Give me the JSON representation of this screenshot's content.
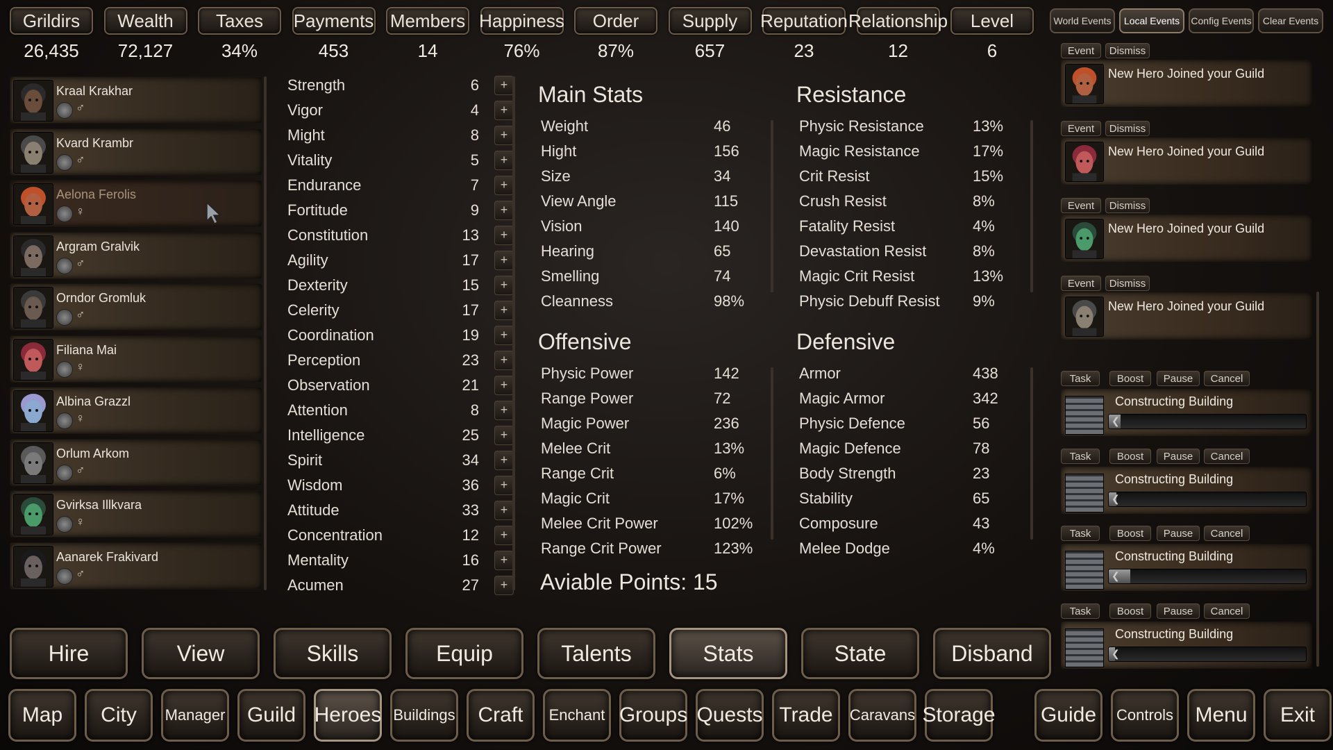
{
  "resources": [
    {
      "label": "Grildirs",
      "value": "26,435"
    },
    {
      "label": "Wealth",
      "value": "72,127"
    },
    {
      "label": "Taxes",
      "value": "34%"
    },
    {
      "label": "Payments",
      "value": "453"
    },
    {
      "label": "Members",
      "value": "14"
    },
    {
      "label": "Happiness",
      "value": "76%"
    },
    {
      "label": "Order",
      "value": "87%"
    },
    {
      "label": "Supply",
      "value": "657"
    },
    {
      "label": "Reputation",
      "value": "23"
    },
    {
      "label": "Relationship",
      "value": "12"
    },
    {
      "label": "Level",
      "value": "6"
    }
  ],
  "event_tabs": [
    "World Events",
    "Local Events",
    "Config Events",
    "Clear Events"
  ],
  "heroes": [
    {
      "name": "Kraal Krakhar",
      "gender": "♂"
    },
    {
      "name": "Kvard Krambr",
      "gender": "♂"
    },
    {
      "name": "Aelona Ferolis",
      "gender": "♀"
    },
    {
      "name": "Argram Gralvik",
      "gender": "♂"
    },
    {
      "name": "Orndor Gromluk",
      "gender": "♂"
    },
    {
      "name": "Filiana Mai",
      "gender": "♀"
    },
    {
      "name": "Albina Grazzl",
      "gender": "♀"
    },
    {
      "name": "Orlum Arkom",
      "gender": "♂"
    },
    {
      "name": "Gvirksa Illkvara",
      "gender": "♀"
    },
    {
      "name": "Aanarek Frakivard",
      "gender": "♂"
    }
  ],
  "attributes": [
    {
      "name": "Strength",
      "value": "6"
    },
    {
      "name": "Vigor",
      "value": "4"
    },
    {
      "name": "Might",
      "value": "8"
    },
    {
      "name": "Vitality",
      "value": "5"
    },
    {
      "name": "Endurance",
      "value": "7"
    },
    {
      "name": "Fortitude",
      "value": "9"
    },
    {
      "name": "Constitution",
      "value": "13"
    },
    {
      "name": "Agility",
      "value": "17"
    },
    {
      "name": "Dexterity",
      "value": "15"
    },
    {
      "name": "Celerity",
      "value": "17"
    },
    {
      "name": "Coordination",
      "value": "19"
    },
    {
      "name": "Perception",
      "value": "23"
    },
    {
      "name": "Observation",
      "value": "21"
    },
    {
      "name": "Attention",
      "value": "8"
    },
    {
      "name": "Intelligence",
      "value": "25"
    },
    {
      "name": "Spirit",
      "value": "34"
    },
    {
      "name": "Wisdom",
      "value": "36"
    },
    {
      "name": "Attitude",
      "value": "33"
    },
    {
      "name": "Concentration",
      "value": "12"
    },
    {
      "name": "Mentality",
      "value": "16"
    },
    {
      "name": "Acumen",
      "value": "27"
    }
  ],
  "plus_label": "+",
  "main_stats": {
    "title": "Main Stats",
    "items": [
      {
        "name": "Weight",
        "value": "46"
      },
      {
        "name": "Hight",
        "value": "156"
      },
      {
        "name": "Size",
        "value": "34"
      },
      {
        "name": "View Angle",
        "value": "115"
      },
      {
        "name": "Vision",
        "value": "140"
      },
      {
        "name": "Hearing",
        "value": "65"
      },
      {
        "name": "Smelling",
        "value": "74"
      },
      {
        "name": "Cleanness",
        "value": "98%"
      }
    ]
  },
  "resistance": {
    "title": "Resistance",
    "items": [
      {
        "name": "Physic Resistance",
        "value": "13%"
      },
      {
        "name": "Magic Resistance",
        "value": "17%"
      },
      {
        "name": "Crit Resist",
        "value": "15%"
      },
      {
        "name": "Crush Resist",
        "value": "8%"
      },
      {
        "name": "Fatality Resist",
        "value": "4%"
      },
      {
        "name": "Devastation Resist",
        "value": "8%"
      },
      {
        "name": "Magic Crit Resist",
        "value": "13%"
      },
      {
        "name": "Physic Debuff Resist",
        "value": "9%"
      }
    ]
  },
  "offensive": {
    "title": "Offensive",
    "items": [
      {
        "name": "Physic Power",
        "value": "142"
      },
      {
        "name": "Range Power",
        "value": "72"
      },
      {
        "name": "Magic Power",
        "value": "236"
      },
      {
        "name": "Melee Crit",
        "value": "13%"
      },
      {
        "name": "Range Crit",
        "value": "6%"
      },
      {
        "name": "Magic Crit",
        "value": "17%"
      },
      {
        "name": "Melee Crit Power",
        "value": "102%"
      },
      {
        "name": "Range Crit Power",
        "value": "123%"
      }
    ]
  },
  "defensive": {
    "title": "Defensive",
    "items": [
      {
        "name": "Armor",
        "value": "438"
      },
      {
        "name": "Magic Armor",
        "value": "342"
      },
      {
        "name": "Physic Defence",
        "value": "56"
      },
      {
        "name": "Magic Defence",
        "value": "78"
      },
      {
        "name": "Body Strength",
        "value": "23"
      },
      {
        "name": "Stability",
        "value": "65"
      },
      {
        "name": "Composure",
        "value": "43"
      },
      {
        "name": "Melee Dodge",
        "value": "4%"
      }
    ]
  },
  "available_points": "Aviable Points: 15",
  "events": [
    {
      "event_label": "Event",
      "dismiss_label": "Dismiss",
      "text": "New Hero Joined your Guild"
    },
    {
      "event_label": "Event",
      "dismiss_label": "Dismiss",
      "text": "New Hero Joined your Guild"
    },
    {
      "event_label": "Event",
      "dismiss_label": "Dismiss",
      "text": "New Hero Joined your Guild"
    },
    {
      "event_label": "Event",
      "dismiss_label": "Dismiss",
      "text": "New Hero Joined your Guild"
    }
  ],
  "tasks": [
    {
      "task_label": "Task",
      "boost_label": "Boost",
      "pause_label": "Pause",
      "cancel_label": "Cancel",
      "text": "Constructing Building",
      "progress": 0.06
    },
    {
      "task_label": "Task",
      "boost_label": "Boost",
      "pause_label": "Pause",
      "cancel_label": "Cancel",
      "text": "Constructing Building",
      "progress": 0.04
    },
    {
      "task_label": "Task",
      "boost_label": "Boost",
      "pause_label": "Pause",
      "cancel_label": "Cancel",
      "text": "Constructing Building",
      "progress": 0.11
    },
    {
      "task_label": "Task",
      "boost_label": "Boost",
      "pause_label": "Pause",
      "cancel_label": "Cancel",
      "text": "Constructing Building",
      "progress": 0.03
    }
  ],
  "actions": [
    "Hire",
    "View",
    "Skills",
    "Equip",
    "Talents",
    "Stats",
    "State",
    "Disband"
  ],
  "active_action": "Stats",
  "nav": [
    "Map",
    "City",
    "Manager",
    "Guild",
    "Heroes",
    "Buildings",
    "Craft",
    "Enchant",
    "Groups",
    "Quests",
    "Trade",
    "Caravans",
    "Storage",
    "Guide",
    "Controls",
    "Menu",
    "Exit"
  ],
  "active_nav": "Heroes"
}
